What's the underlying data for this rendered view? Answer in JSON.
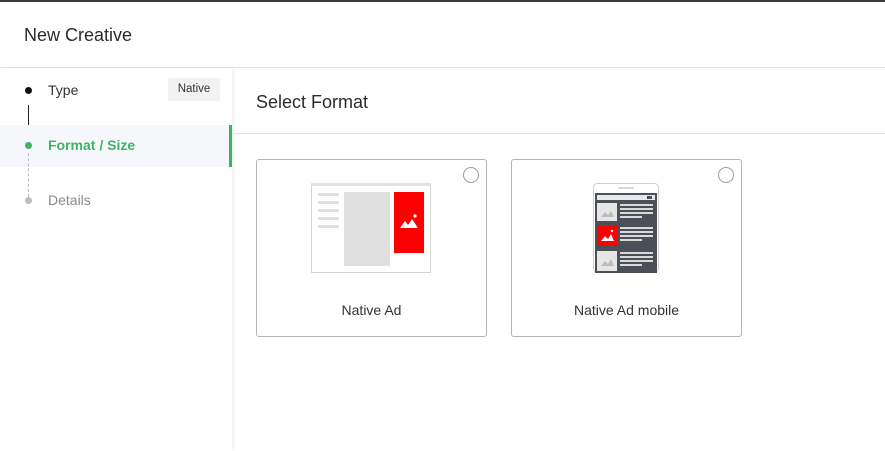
{
  "dialog": {
    "title": "New Creative"
  },
  "steps": [
    {
      "label": "Type",
      "value": "Native",
      "state": "completed"
    },
    {
      "label": "Format / Size",
      "state": "active"
    },
    {
      "label": "Details",
      "state": "pending"
    }
  ],
  "main": {
    "title": "Select Format",
    "formats": [
      {
        "label": "Native Ad",
        "selected": false
      },
      {
        "label": "Native Ad mobile",
        "selected": false
      }
    ]
  },
  "colors": {
    "accent": "#3db465",
    "ad_red": "#ff0000",
    "mobile_dark": "#4a4f58"
  }
}
